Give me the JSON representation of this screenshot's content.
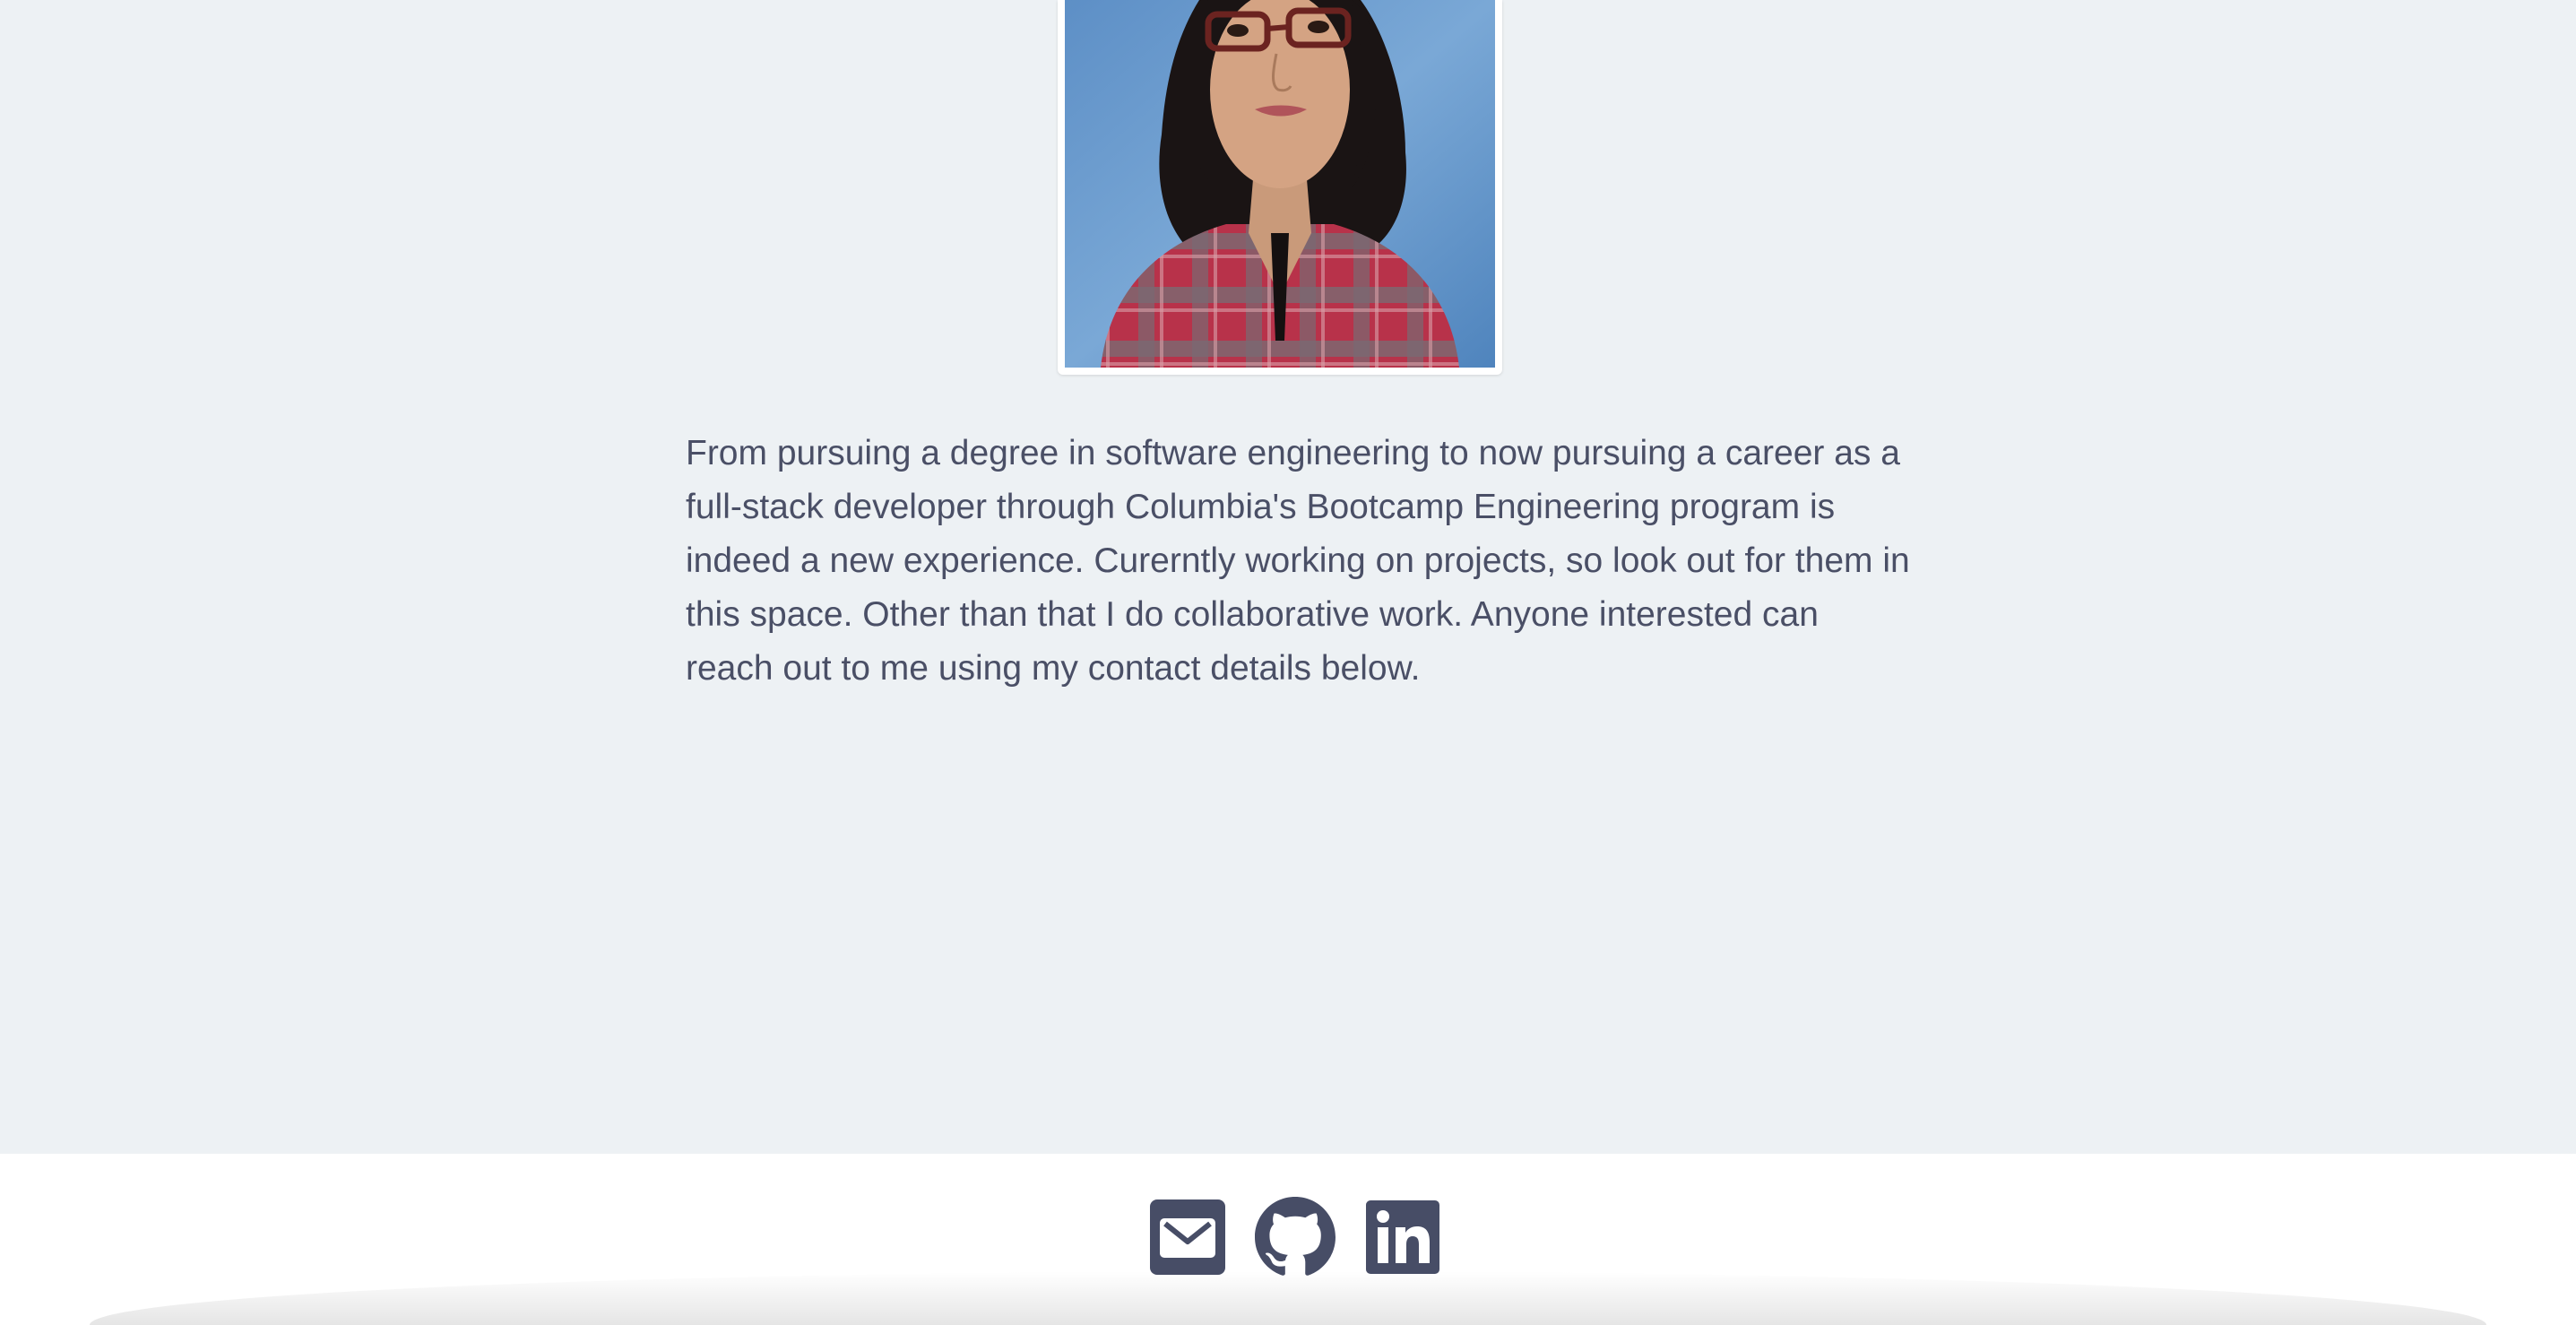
{
  "about": {
    "photo_alt": "Profile photo",
    "bio": "From pursuing a degree in software engineering to now pursuing a career as a full-stack developer through Columbia's Bootcamp Engineering program is indeed a new experience. Curerntly working on projects, so look out for them in this space. Other than that I do collaborative work. Anyone interested can reach out to me using my contact details below."
  },
  "footer": {
    "links": [
      {
        "name": "email",
        "icon": "envelope-icon"
      },
      {
        "name": "github",
        "icon": "github-icon"
      },
      {
        "name": "linkedin",
        "icon": "linkedin-icon"
      }
    ]
  },
  "colors": {
    "page_background": "#edf1f4",
    "text": "#4a4f66",
    "icon": "#474d66",
    "footer_background": "#ffffff"
  }
}
